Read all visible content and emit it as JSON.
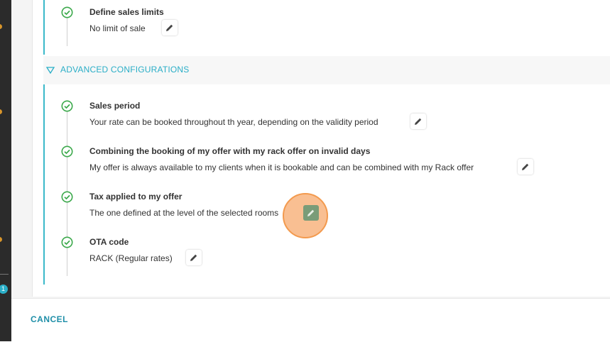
{
  "rail": {
    "badge": "1"
  },
  "top_group": {
    "items": [
      {
        "title": "Define sales limits",
        "value": "No limit of sale"
      }
    ]
  },
  "advanced": {
    "title": "ADVANCED CONFIGURATIONS",
    "items": [
      {
        "title": "Sales period",
        "value": "Your rate can be booked throughout th year, depending on the validity period"
      },
      {
        "title": "Combining the booking of my offer with my rack offer on invalid days",
        "value": "My offer is always available to my clients when it is bookable and can be combined with my Rack offer"
      },
      {
        "title": "Tax applied to my offer",
        "value": "The one defined at the level of the selected rooms"
      },
      {
        "title": "OTA code",
        "value": "RACK (Regular rates)"
      }
    ]
  },
  "footer": {
    "cancel_label": "CANCEL"
  },
  "colors": {
    "accent": "#2aaec7",
    "check": "#3aa84a",
    "highlight": "#f39a4e"
  },
  "icons": [
    "check-circle-icon",
    "pencil-icon",
    "triangle-down-icon"
  ]
}
